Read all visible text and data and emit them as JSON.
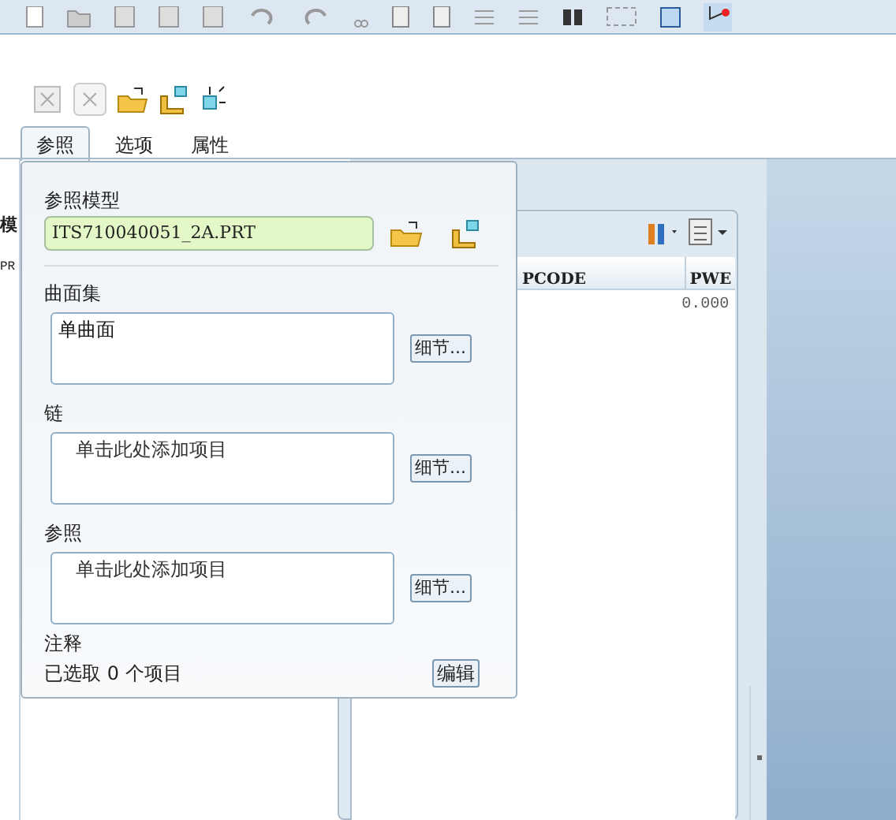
{
  "tabs": [
    {
      "label": "参照",
      "selected": true
    },
    {
      "label": "选项",
      "selected": false
    },
    {
      "label": "属性",
      "selected": false
    }
  ],
  "side_strip": {
    "texts": [
      "模",
      "PR"
    ]
  },
  "table": {
    "columns": [
      "PCODE",
      "PWE"
    ],
    "rows": [
      [
        "",
        "0.000"
      ]
    ]
  },
  "panel": {
    "model_label": "参照模型",
    "model_value": "ITS710040051_2A.PRT",
    "collectors": [
      {
        "label": "曲面集",
        "content": "单曲面",
        "filled": true,
        "button": "细节..."
      },
      {
        "label": "链",
        "content": "单击此处添加项目",
        "filled": false,
        "button": "细节..."
      },
      {
        "label": "参照",
        "content": "单击此处添加项目",
        "filled": false,
        "button": "细节..."
      }
    ],
    "notes_label": "注释",
    "selection": "已选取 0 个项目",
    "edit_button": "编辑"
  }
}
